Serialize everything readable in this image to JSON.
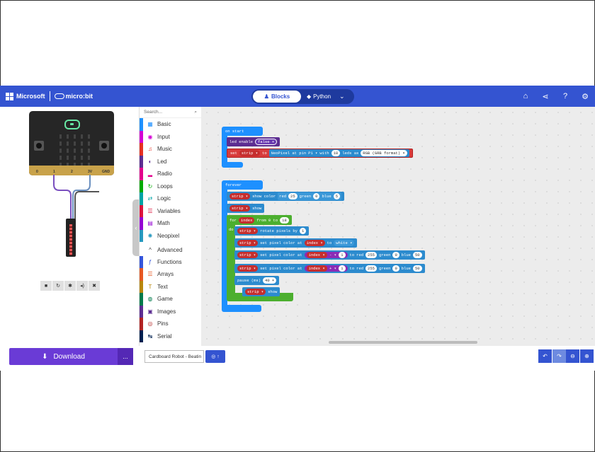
{
  "header": {
    "brand_company": "Microsoft",
    "brand_product": "micro:bit",
    "mode_blocks": "Blocks",
    "mode_python": "Python",
    "colors": {
      "header_bg": "#3454d1",
      "download": "#6a3bd6"
    }
  },
  "simulator": {
    "pins": [
      "0",
      "1",
      "2",
      "3V",
      "GND"
    ],
    "buttons": [
      "A",
      "B"
    ]
  },
  "toolbox": {
    "search_placeholder": "Search...",
    "categories": [
      {
        "label": "Basic",
        "icon": "grid-icon",
        "color": "#1e90ff"
      },
      {
        "label": "Input",
        "icon": "input-icon",
        "color": "#d400d4"
      },
      {
        "label": "Music",
        "icon": "headphones-icon",
        "color": "#e63022"
      },
      {
        "label": "Led",
        "icon": "toggle-icon",
        "color": "#5c2d91"
      },
      {
        "label": "Radio",
        "icon": "signal-icon",
        "color": "#e3008c"
      },
      {
        "label": "Loops",
        "icon": "refresh-icon",
        "color": "#00aa00"
      },
      {
        "label": "Logic",
        "icon": "shuffle-icon",
        "color": "#00a4a6"
      },
      {
        "label": "Variables",
        "icon": "list-icon",
        "color": "#dc143c"
      },
      {
        "label": "Math",
        "icon": "calculator-icon",
        "color": "#9400d3"
      },
      {
        "label": "Neopixel",
        "icon": "spinner-icon",
        "color": "#2699bf"
      }
    ],
    "advanced_label": "Advanced",
    "advanced": [
      {
        "label": "Functions",
        "icon": "function-icon",
        "color": "#3455db"
      },
      {
        "label": "Arrays",
        "icon": "list-icon",
        "color": "#e65722"
      },
      {
        "label": "Text",
        "icon": "text-icon",
        "color": "#b8860b"
      },
      {
        "label": "Game",
        "icon": "gamepad-icon",
        "color": "#007a4b"
      },
      {
        "label": "Images",
        "icon": "image-icon",
        "color": "#5c2d91"
      },
      {
        "label": "Pins",
        "icon": "pin-icon",
        "color": "#b22222"
      },
      {
        "label": "Serial",
        "icon": "serial-icon",
        "color": "#002050"
      }
    ]
  },
  "workspace": {
    "on_start": "on start",
    "led_enable": "led enable",
    "false_val": "false ▾",
    "set": "set",
    "strip": "strip ▾",
    "to": "to",
    "neopixel_at": "NeoPixel at pin",
    "pin_p1": "P1 ▾",
    "with": "with",
    "led_count": "18",
    "leds_as": "leds as",
    "rgb_format": "RGB (GRB format) ▾",
    "forever": "forever",
    "show_color": "show color",
    "red": "red",
    "green": "green",
    "blue": "blue",
    "red_val": "25",
    "green_val": "0",
    "blue_val": "5",
    "show": "show",
    "for": "for",
    "index": "index",
    "from_0_to": "from 0 to",
    "for_end": "18",
    "do": "do",
    "rotate_pixels_by": "rotate pixels by",
    "rotate_val": "1",
    "set_pixel_color_at": "set pixel color at",
    "index_drop": "index ▾",
    "white": "white ▾",
    "minus": "- ▾",
    "plus": "+ ▾",
    "one": "1",
    "red255": "255",
    "zero": "0",
    "fifty": "50",
    "pause": "pause (ms)",
    "pause_val": "40 ▾"
  },
  "bottombar": {
    "download": "Download",
    "more": "...",
    "project_name": "Cardboard Robot - Beatin",
    "github": "↑"
  }
}
